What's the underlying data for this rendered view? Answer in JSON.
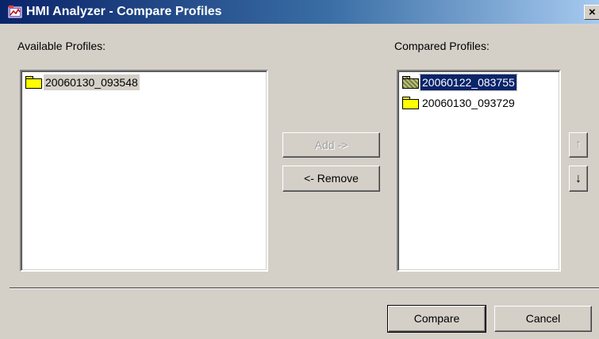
{
  "window": {
    "title": "HMI Analyzer - Compare Profiles",
    "close_glyph": "×",
    "icon": "hmi-analyzer-app-icon"
  },
  "available": {
    "label": "Available Profiles:",
    "items": [
      {
        "name": "20060130_093548",
        "icon": "folder-icon",
        "selected": false
      }
    ]
  },
  "compared": {
    "label": "Compared Profiles:",
    "items": [
      {
        "name": "20060122_083755",
        "icon": "folder-icon",
        "selected": true
      },
      {
        "name": "20060130_093729",
        "icon": "folder-icon",
        "selected": false
      }
    ]
  },
  "buttons": {
    "add": "Add ->",
    "remove": "<- Remove",
    "move_up": "↑",
    "move_down": "↓",
    "compare": "Compare",
    "cancel": "Cancel"
  }
}
